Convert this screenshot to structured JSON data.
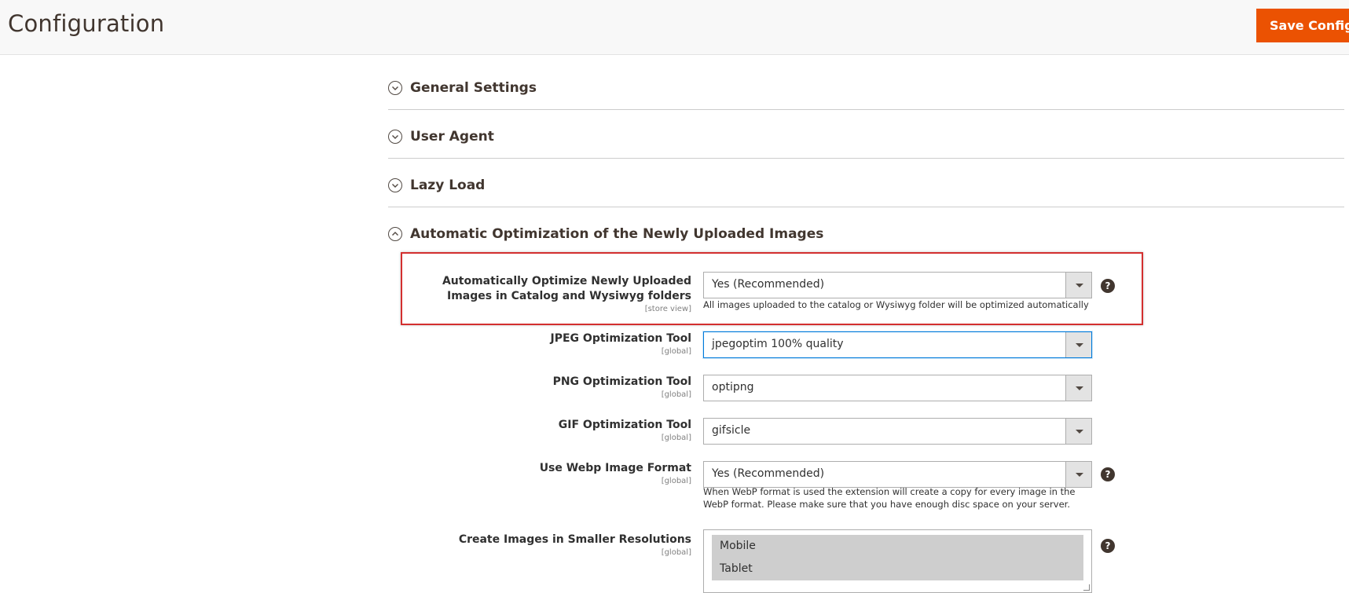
{
  "header": {
    "title": "Configuration",
    "save_label": "Save Config"
  },
  "sections": [
    {
      "title": "General Settings",
      "expanded": false
    },
    {
      "title": "User Agent",
      "expanded": false
    },
    {
      "title": "Lazy Load",
      "expanded": false
    },
    {
      "title": "Automatic Optimization of the Newly Uploaded Images",
      "expanded": true
    }
  ],
  "fields": {
    "auto_optimize": {
      "label": "Automatically Optimize Newly Uploaded Images in Catalog and Wysiwyg folders",
      "scope": "[store view]",
      "value": "Yes (Recommended)",
      "note": "All images uploaded to the catalog or Wysiwyg folder will be optimized automatically"
    },
    "jpeg_tool": {
      "label": "JPEG Optimization Tool",
      "scope": "[global]",
      "value": "jpegoptim 100% quality"
    },
    "png_tool": {
      "label": "PNG Optimization Tool",
      "scope": "[global]",
      "value": "optipng"
    },
    "gif_tool": {
      "label": "GIF Optimization Tool",
      "scope": "[global]",
      "value": "gifsicle"
    },
    "webp": {
      "label": "Use Webp Image Format",
      "scope": "[global]",
      "value": "Yes (Recommended)",
      "note": "When WebP format is used the extension will create a copy for every image in the WebP format. Please make sure that you have enough disc space on your server."
    },
    "resolutions": {
      "label": "Create Images in Smaller Resolutions",
      "scope": "[global]",
      "options": [
        "Mobile",
        "Tablet"
      ]
    }
  },
  "colors": {
    "accent": "#eb5202",
    "highlight_border": "#d32f2f",
    "focus_border": "#007bdb"
  },
  "icons": {
    "collapsed": "chevron-down-circle-icon",
    "expanded": "chevron-up-circle-icon",
    "help": "question-circle-icon"
  }
}
